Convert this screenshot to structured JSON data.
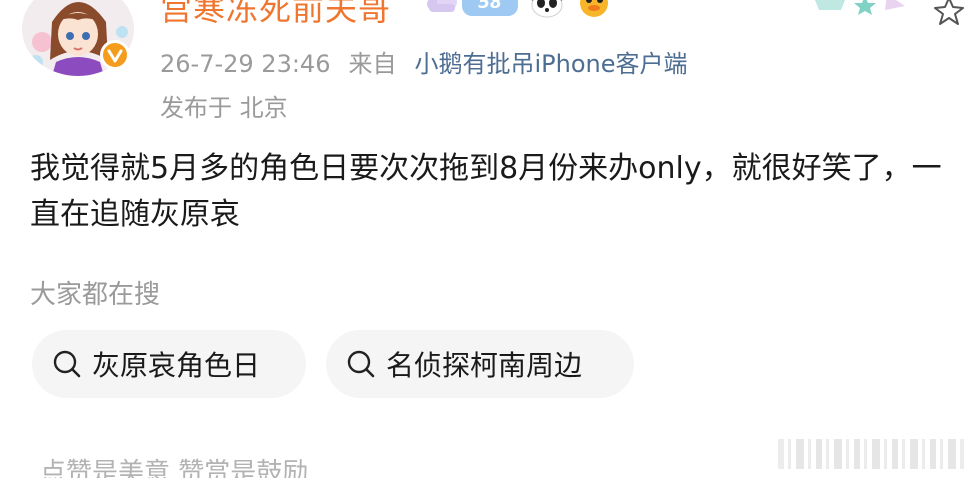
{
  "post": {
    "author": {
      "username": "宫寒冻死前夫哥",
      "level_badge": "58",
      "verified_icon": "verified-v-icon"
    },
    "meta": {
      "datetime": "26-7-29 23:46",
      "source_prefix": "来自",
      "client": "小鹅有批吊iPhone客户端",
      "location": "发布于 北京"
    },
    "text": "我觉得就5月多的角色日要次次拖到8月份来办only，就很好笑了，一直在追随灰原哀"
  },
  "search": {
    "title": "大家都在搜",
    "items": [
      {
        "label": "灰原哀角色日",
        "icon": "search-icon"
      },
      {
        "label": "名侦探柯南周边",
        "icon": "search-icon"
      }
    ]
  },
  "footer": {
    "text": "点赞是美意  赞赏是鼓励"
  },
  "colors": {
    "username": "#f0762f",
    "client_link": "#4d6d93",
    "muted": "#9a9a9a",
    "pill_bg": "#f5f5f5",
    "verified": "#f59b1d"
  }
}
